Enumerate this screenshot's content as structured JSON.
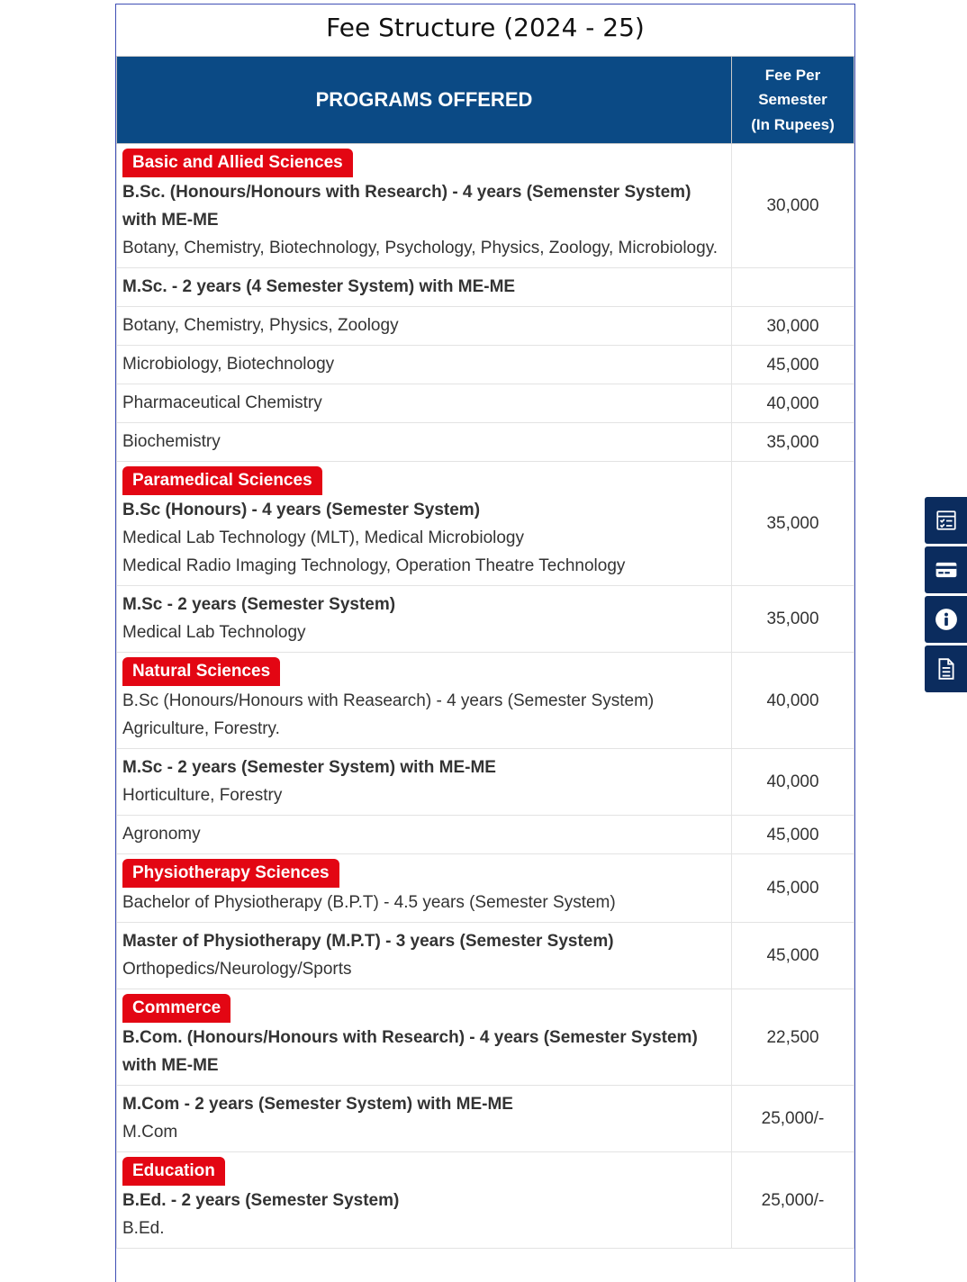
{
  "title": "Fee Structure (2024 - 25)",
  "header": {
    "programs": "PROGRAMS OFFERED",
    "fee_line1": "Fee Per",
    "fee_line2": "Semester",
    "fee_line3": "(In Rupees)"
  },
  "rows": [
    {
      "category": "Basic and Allied Sciences",
      "bold": "B.Sc. (Honours/Honours with Research) - 4 years (Semenster System) with ME-ME",
      "plain": [
        "Botany, Chemistry, Biotechnology, Psychology, Physics, Zoology, Microbiology."
      ],
      "fee": "30,000"
    },
    {
      "category": "",
      "bold": "M.Sc. - 2 years (4 Semester System) with ME-ME",
      "plain": [],
      "fee": ""
    },
    {
      "category": "",
      "bold": "",
      "plain": [
        "Botany, Chemistry, Physics, Zoology"
      ],
      "fee": "30,000"
    },
    {
      "category": "",
      "bold": "",
      "plain": [
        "Microbiology, Biotechnology"
      ],
      "fee": "45,000"
    },
    {
      "category": "",
      "bold": "",
      "plain": [
        "Pharmaceutical Chemistry"
      ],
      "fee": "40,000"
    },
    {
      "category": "",
      "bold": "",
      "plain": [
        "Biochemistry"
      ],
      "fee": "35,000"
    },
    {
      "category": "Paramedical Sciences",
      "bold": "B.Sc (Honours) - 4 years (Semester System)",
      "plain": [
        "Medical Lab Technology (MLT), Medical Microbiology",
        "Medical Radio Imaging Technology, Operation Theatre Technology"
      ],
      "fee": "35,000"
    },
    {
      "category": "",
      "bold": "M.Sc - 2 years (Semester System)",
      "plain": [
        "Medical Lab Technology"
      ],
      "fee": "35,000"
    },
    {
      "category": "Natural Sciences",
      "bold": "",
      "plain": [
        "B.Sc (Honours/Honours with Reasearch) - 4 years (Semester System)",
        "Agriculture, Forestry."
      ],
      "fee": "40,000"
    },
    {
      "category": "",
      "bold": "M.Sc - 2 years (Semester System) with ME-ME",
      "plain": [
        "Horticulture, Forestry"
      ],
      "fee": "40,000"
    },
    {
      "category": "",
      "bold": "",
      "plain": [
        "Agronomy"
      ],
      "fee": "45,000"
    },
    {
      "category": "Physiotherapy Sciences",
      "bold": "",
      "plain": [
        "Bachelor of Physiotherapy (B.P.T) - 4.5 years (Semester System)"
      ],
      "fee": "45,000"
    },
    {
      "category": "",
      "bold": "Master of Physiotherapy (M.P.T) - 3 years (Semester System)",
      "plain": [
        "Orthopedics/Neurology/Sports"
      ],
      "fee": "45,000"
    },
    {
      "category": "Commerce",
      "bold": "B.Com. (Honours/Honours with Research) - 4 years (Semester System) with ME-ME",
      "plain": [],
      "fee": "22,500"
    },
    {
      "category": "",
      "bold": "M.Com - 2 years (Semester System) with ME-ME",
      "plain": [
        "M.Com"
      ],
      "fee": "25,000/-"
    },
    {
      "category": "Education",
      "bold": "B.Ed. - 2 years (Semester System)",
      "plain": [
        "B.Ed."
      ],
      "fee": "25,000/-"
    }
  ],
  "side_buttons": [
    "apply-form-icon",
    "payment-card-icon",
    "info-icon",
    "brochure-document-icon"
  ],
  "colors": {
    "header_bg": "#0b4a85",
    "badge_bg": "#e30613",
    "side_bg": "#0b2c5e"
  }
}
